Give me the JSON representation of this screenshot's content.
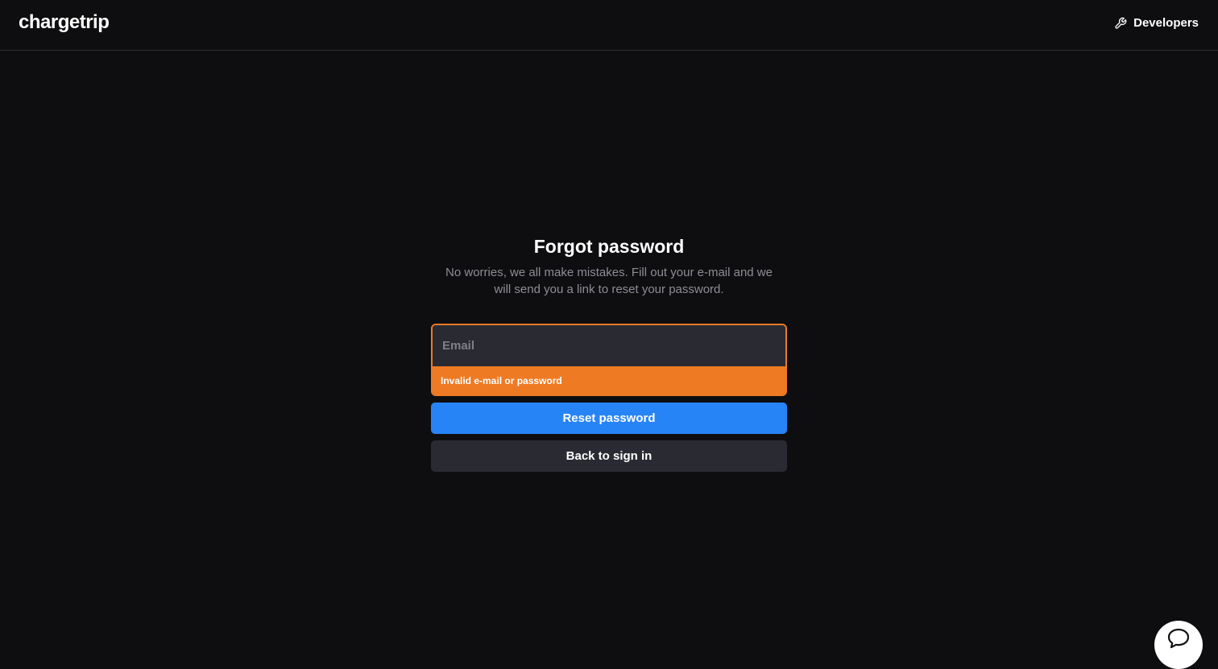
{
  "header": {
    "logo": "chargetrip",
    "developers_label": "Developers",
    "developers_icon": "wrench-icon"
  },
  "form": {
    "title": "Forgot password",
    "subtitle": "No worries, we all make mistakes. Fill out your e-mail and we will send you a link to reset your password.",
    "email_placeholder": "Email",
    "email_value": "",
    "error_message": "Invalid e-mail or password",
    "reset_button": "Reset password",
    "back_button": "Back to sign in"
  },
  "chat": {
    "icon": "chat-bubble-icon"
  },
  "colors": {
    "background": "#0e0e10",
    "accent_blue": "#2784f6",
    "error_orange": "#ef7a24",
    "input_bg": "#2a2b32"
  }
}
